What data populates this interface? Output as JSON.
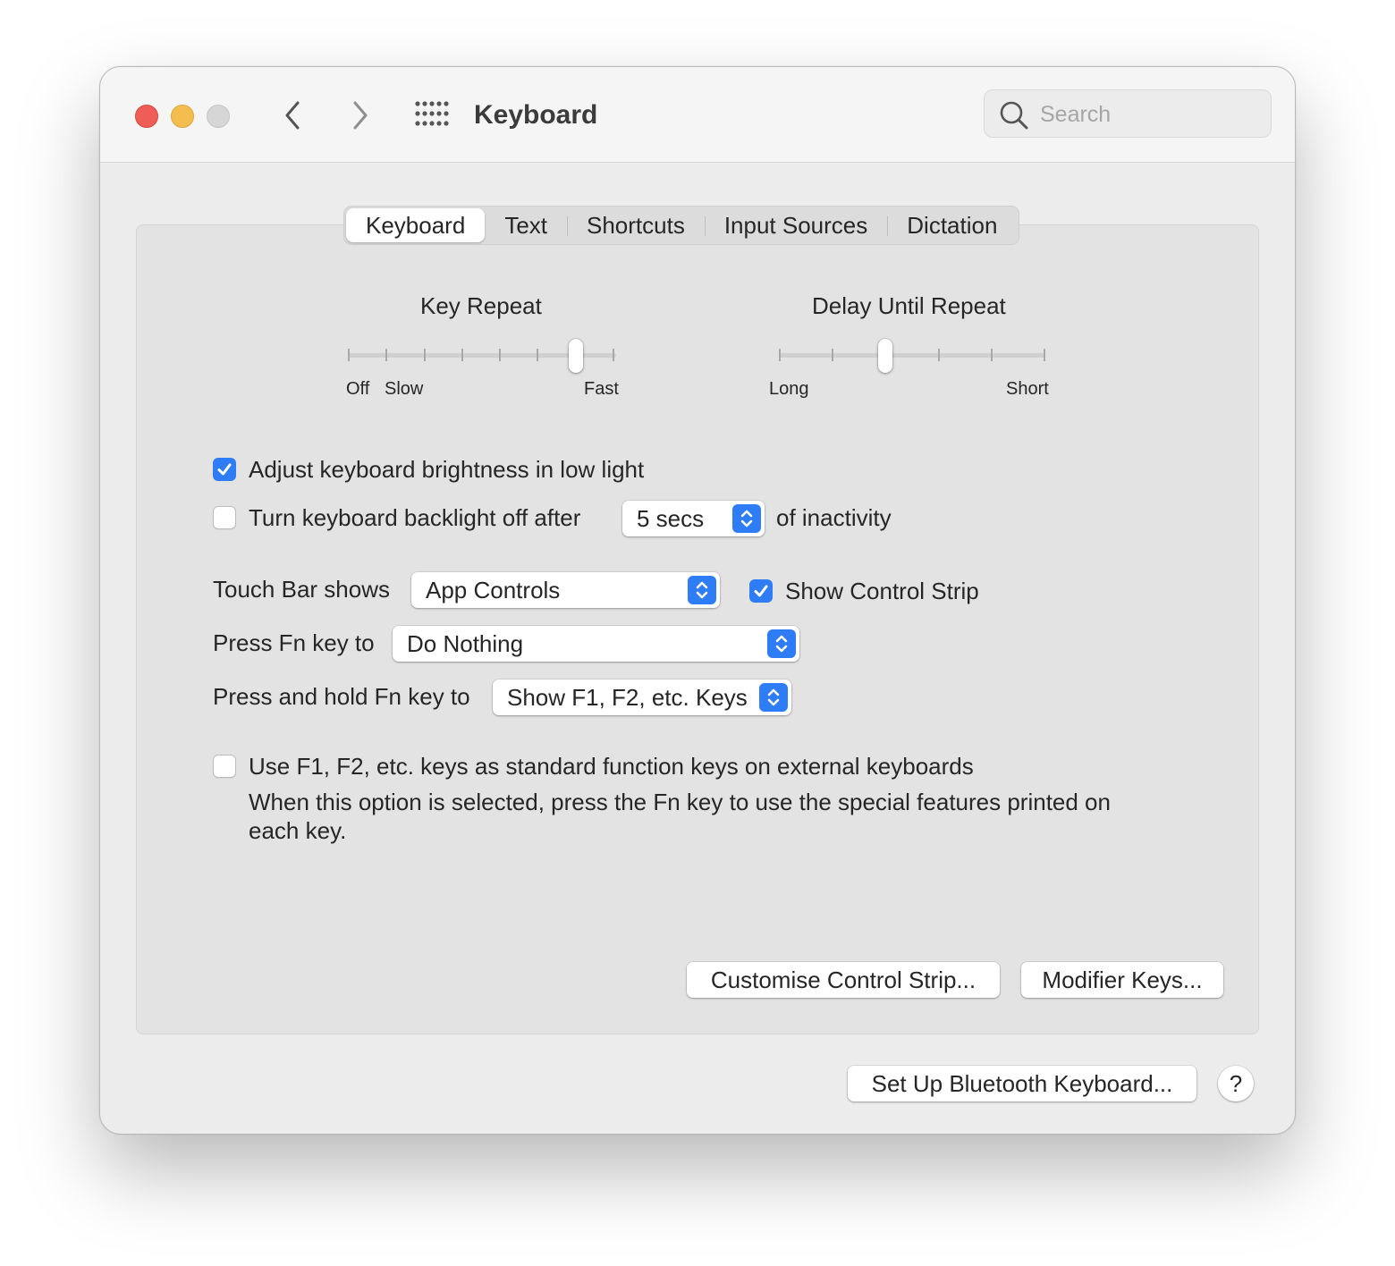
{
  "window": {
    "title": "Keyboard",
    "search_placeholder": "Search"
  },
  "tabs": [
    {
      "label": "Keyboard",
      "active": true
    },
    {
      "label": "Text",
      "active": false
    },
    {
      "label": "Shortcuts",
      "active": false
    },
    {
      "label": "Input Sources",
      "active": false
    },
    {
      "label": "Dictation",
      "active": false
    }
  ],
  "key_repeat": {
    "title": "Key Repeat",
    "label_off": "Off",
    "label_slow": "Slow",
    "label_fast": "Fast",
    "tick_count": 8,
    "selected_index": 6
  },
  "delay_until_repeat": {
    "title": "Delay Until Repeat",
    "label_long": "Long",
    "label_short": "Short",
    "tick_count": 6,
    "selected_index": 2
  },
  "options": {
    "adjust_brightness": {
      "label": "Adjust keyboard brightness in low light",
      "checked": true
    },
    "backlight_off": {
      "label": "Turn keyboard backlight off after",
      "checked": false,
      "value": "5 secs",
      "suffix": "of inactivity"
    },
    "touch_bar": {
      "label": "Touch Bar shows",
      "value": "App Controls"
    },
    "show_control_strip": {
      "label": "Show Control Strip",
      "checked": true
    },
    "press_fn": {
      "label": "Press Fn key to",
      "value": "Do Nothing"
    },
    "hold_fn": {
      "label": "Press and hold Fn key to",
      "value": "Show F1, F2, etc. Keys"
    },
    "standard_fn_keys": {
      "label": "Use F1, F2, etc. keys as standard function keys on external keyboards",
      "checked": false,
      "description_line1": "When this option is selected, press the Fn key to use the special features printed on",
      "description_line2": "each key."
    }
  },
  "buttons": {
    "customise": "Customise Control Strip...",
    "modifier": "Modifier Keys...",
    "bluetooth": "Set Up Bluetooth Keyboard...",
    "help": "?"
  },
  "colors": {
    "accent": "#2f7df6",
    "close": "#ee5e57",
    "minimize": "#f4bd4f",
    "zoom_disabled": "#d6d6d6"
  }
}
